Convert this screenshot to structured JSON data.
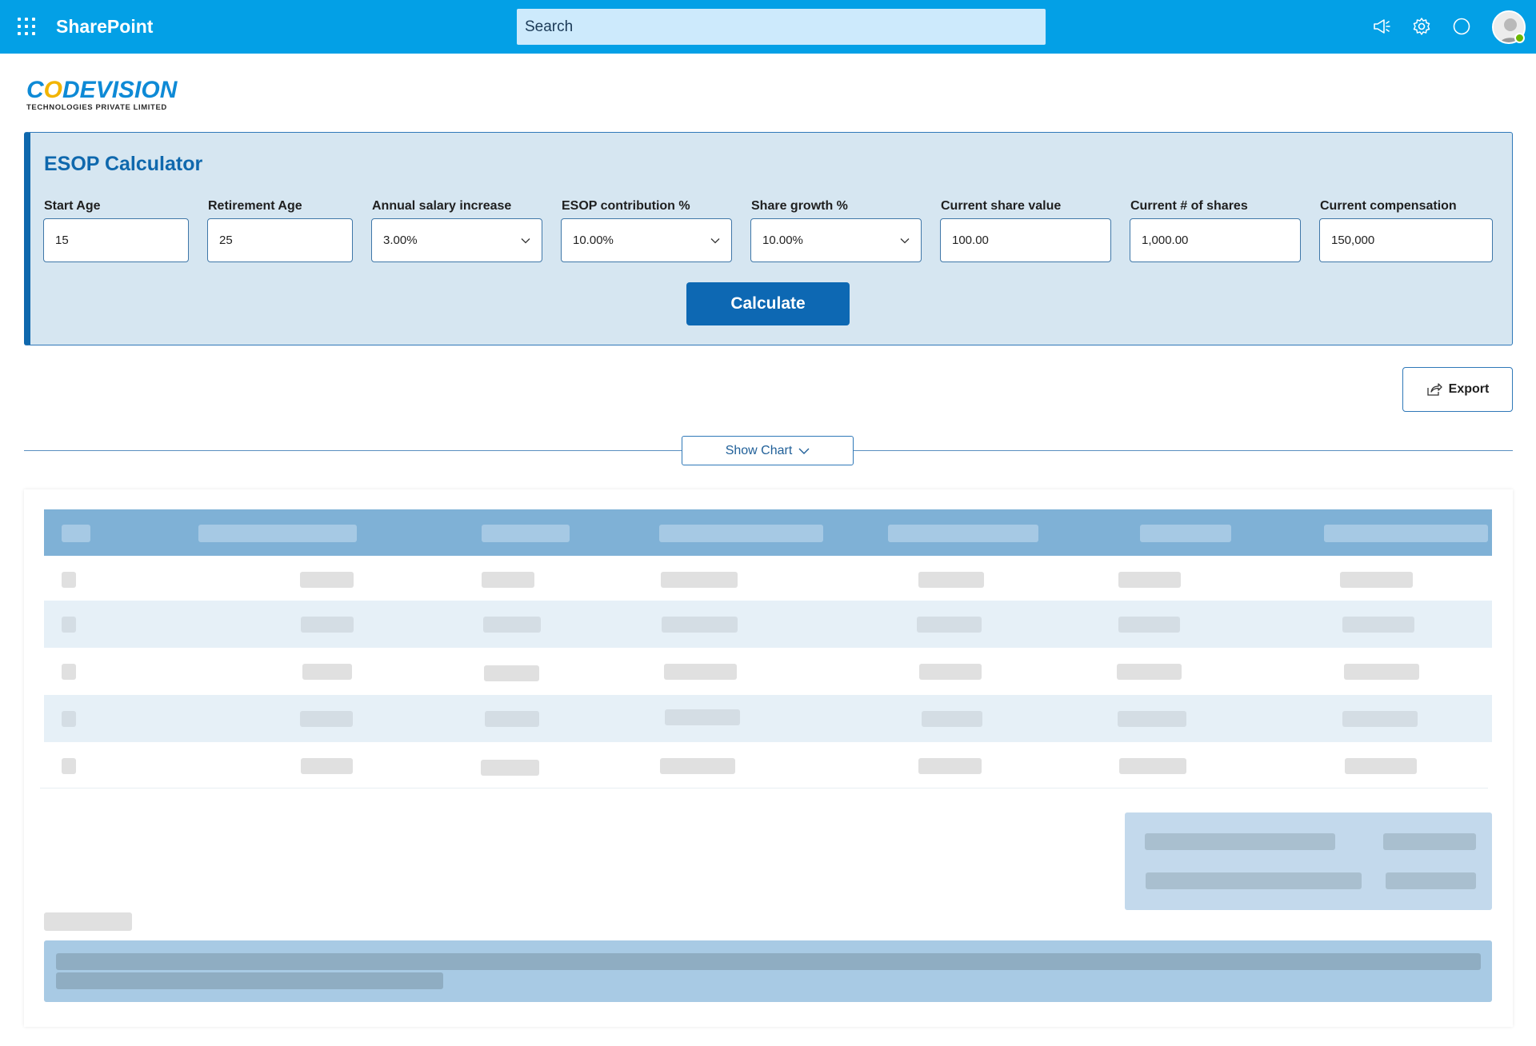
{
  "topbar": {
    "app_name": "SharePoint",
    "search_placeholder": "Search",
    "icons": [
      "app-launcher-icon",
      "megaphone-icon",
      "gear-icon",
      "help-circle-icon",
      "avatar"
    ],
    "accent": "#03a0e6"
  },
  "logo": {
    "main": "CODEVISION",
    "sub": "TECHNOLOGIES PRIVATE LIMITED"
  },
  "calculator": {
    "title": "ESOP Calculator",
    "fields": [
      {
        "label": "Start Age",
        "value": "15",
        "type": "input"
      },
      {
        "label": "Retirement Age",
        "value": "25",
        "type": "input"
      },
      {
        "label": "Annual salary increase",
        "value": "3.00%",
        "type": "select"
      },
      {
        "label": "ESOP contribution %",
        "value": "10.00%",
        "type": "select"
      },
      {
        "label": "Share growth %",
        "value": "10.00%",
        "type": "select"
      },
      {
        "label": "Current share value",
        "value": "100.00",
        "type": "input"
      },
      {
        "label": "Current # of shares",
        "value": "1,000.00",
        "type": "input"
      },
      {
        "label": "Current compensation",
        "value": "150,000",
        "type": "input"
      }
    ],
    "calculate_label": "Calculate",
    "primary_color": "#0d68b3"
  },
  "actions": {
    "export_label": "Export",
    "show_chart_label": "Show Chart"
  },
  "table": {
    "state": "loading",
    "header_color": "#7fb1d6",
    "alt_row_color": "#e6f0f7"
  }
}
